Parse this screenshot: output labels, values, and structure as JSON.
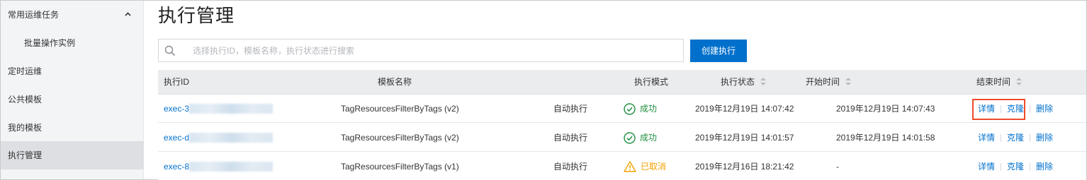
{
  "sidebar": {
    "items": [
      {
        "label": "常用运维任务"
      },
      {
        "label": "批量操作实例"
      },
      {
        "label": "定时运维"
      },
      {
        "label": "公共模板"
      },
      {
        "label": "我的模板"
      },
      {
        "label": "执行管理"
      }
    ],
    "collapse_glyph": "^"
  },
  "page": {
    "title": "执行管理"
  },
  "search": {
    "placeholder": "选择执行ID，模板名称，执行状态进行搜索",
    "value": "",
    "icon": "search-icon"
  },
  "toolbar": {
    "create_label": "创建执行"
  },
  "table": {
    "headers": {
      "exec_id": "执行ID",
      "template": "模板名称",
      "mode": "执行模式",
      "status": "执行状态",
      "start": "开始时间",
      "end": "结束时间"
    },
    "rows": [
      {
        "exec_id": "exec-3",
        "template": "TagResourcesFilterByTags (v2)",
        "mode": "自动执行",
        "status": "成功",
        "start": "2019年12月19日 14:07:42",
        "end": "2019年12月19日 14:07:43",
        "action_detail": "详情",
        "action_clone": "克隆",
        "action_delete": "删除"
      },
      {
        "exec_id": "exec-d",
        "template": "TagResourcesFilterByTags (v2)",
        "mode": "自动执行",
        "status": "成功",
        "start": "2019年12月19日 14:01:57",
        "end": "2019年12月19日 14:01:58",
        "action_detail": "详情",
        "action_clone": "克隆",
        "action_delete": "删除"
      },
      {
        "exec_id": "exec-8",
        "template": "TagResourcesFilterByTags (v1)",
        "mode": "自动执行",
        "status": "已取消",
        "start": "2019年12月16日 18:21:42",
        "end": "-",
        "action_detail": "详情",
        "action_clone": "克隆",
        "action_delete": "删除"
      }
    ]
  },
  "colors": {
    "accent": "#0070cc",
    "success": "#1e8e3e",
    "warning": "#f1a200",
    "highlight": "#ee4b2b"
  }
}
